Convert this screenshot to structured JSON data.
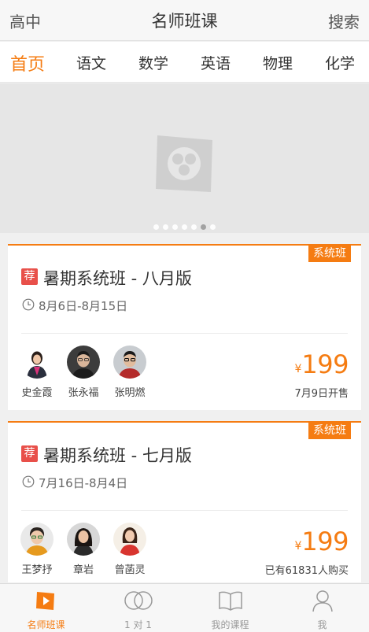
{
  "header": {
    "left_label": "高中",
    "title": "名师班课",
    "right_label": "搜索"
  },
  "subjects": [
    {
      "label": "首页",
      "active": true
    },
    {
      "label": "语文",
      "active": false
    },
    {
      "label": "数学",
      "active": false
    },
    {
      "label": "英语",
      "active": false
    },
    {
      "label": "物理",
      "active": false
    },
    {
      "label": "化学",
      "active": false
    }
  ],
  "banner": {
    "slide_count": 7,
    "active_slide": 6
  },
  "courses": [
    {
      "type_badge": "系统班",
      "rec_badge": "荐",
      "title": "暑期系统班 - 八月版",
      "date": "8月6日-8月15日",
      "teachers": [
        {
          "name": "史金霞"
        },
        {
          "name": "张永福"
        },
        {
          "name": "张明燃"
        }
      ],
      "currency": "¥",
      "price": "199",
      "status": "7月9日开售"
    },
    {
      "type_badge": "系统班",
      "rec_badge": "荐",
      "title": "暑期系统班 - 七月版",
      "date": "7月16日-8月4日",
      "teachers": [
        {
          "name": "王梦抒"
        },
        {
          "name": "章岩"
        },
        {
          "name": "曾菡灵"
        }
      ],
      "currency": "¥",
      "price": "199",
      "status": "已有61831人购买"
    }
  ],
  "bottom_nav": [
    {
      "label": "名师班课",
      "icon": "play-icon",
      "active": true
    },
    {
      "label": "1 对 1",
      "icon": "rings-icon",
      "active": false
    },
    {
      "label": "我的课程",
      "icon": "book-icon",
      "active": false
    },
    {
      "label": "我",
      "icon": "person-icon",
      "active": false
    }
  ],
  "colors": {
    "accent": "#f57c12",
    "recommend": "#e8504a"
  }
}
